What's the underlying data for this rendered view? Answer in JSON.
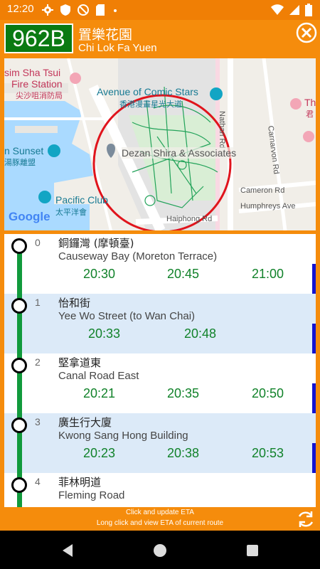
{
  "status_bar": {
    "time": "12:20",
    "left_icons": [
      "gear-icon",
      "shield-icon",
      "blocked-circle-icon",
      "sd-card-icon",
      "dot-icon"
    ],
    "right_icons": [
      "wifi-icon",
      "signal-icon",
      "battery-icon"
    ]
  },
  "header": {
    "route": "962B",
    "dest_zh": "置樂花園",
    "dest_en": "Chi Lok Fa Yuen",
    "close_icon": "close-circle-icon"
  },
  "map": {
    "labels": {
      "fire_station_1": "sim Sha Tsui",
      "fire_station_2": "Fire Station",
      "fire_station_zh": "尖沙咀消防局",
      "comic_en": "Avenue of Comic Stars",
      "comic_zh": "香港漫畫星光大道",
      "nathan": "Nathan Rd",
      "carnarvon": "Carnarvon Rd",
      "sunset_en": "n Sunset",
      "sunset_zh": "湯豚離盟",
      "dezan": "Dezan Shira & Associates",
      "cameron": "Cameron Rd",
      "pacific_en": "Pacific Club",
      "pacific_zh": "太平洋會",
      "humphreys": "Humphreys Ave",
      "haiphong": "Haiphong Rd",
      "tho": "Tho",
      "jun": "君",
      "google": "Google"
    }
  },
  "stops": [
    {
      "seq": "0",
      "name_zh": "銅鑼灣 (摩頓臺)",
      "name_en": "Causeway Bay (Moreton Terrace)",
      "etas": [
        "20:30",
        "20:45",
        "21:00"
      ]
    },
    {
      "seq": "1",
      "name_zh": "怡和街",
      "name_en": "Yee Wo Street (to Wan Chai)",
      "etas": [
        "20:33",
        "20:48"
      ]
    },
    {
      "seq": "2",
      "name_zh": "堅拿道東",
      "name_en": "Canal Road East",
      "etas": [
        "20:21",
        "20:35",
        "20:50"
      ]
    },
    {
      "seq": "3",
      "name_zh": "廣生行大廈",
      "name_en": "Kwong Sang Hong Building",
      "etas": [
        "20:23",
        "20:38",
        "20:53"
      ]
    },
    {
      "seq": "4",
      "name_zh": "菲林明道",
      "name_en": "Fleming Road",
      "etas": []
    }
  ],
  "footer": {
    "line1": "Click and update ETA",
    "line2": "Long click and view ETA of current route",
    "refresh_icon": "refresh-icon"
  },
  "navbar": {
    "back_icon": "back-triangle-icon",
    "home_icon": "home-circle-icon",
    "recents_icon": "recents-square-icon"
  },
  "colors": {
    "header_bg": "#f58c0c",
    "route_box": "#0a7a12",
    "rail": "#119a3c",
    "eta_text": "#11822a",
    "row_shade": "#dceaf8",
    "edge_bar": "#1313d0",
    "map_circle": "#e0141c"
  }
}
